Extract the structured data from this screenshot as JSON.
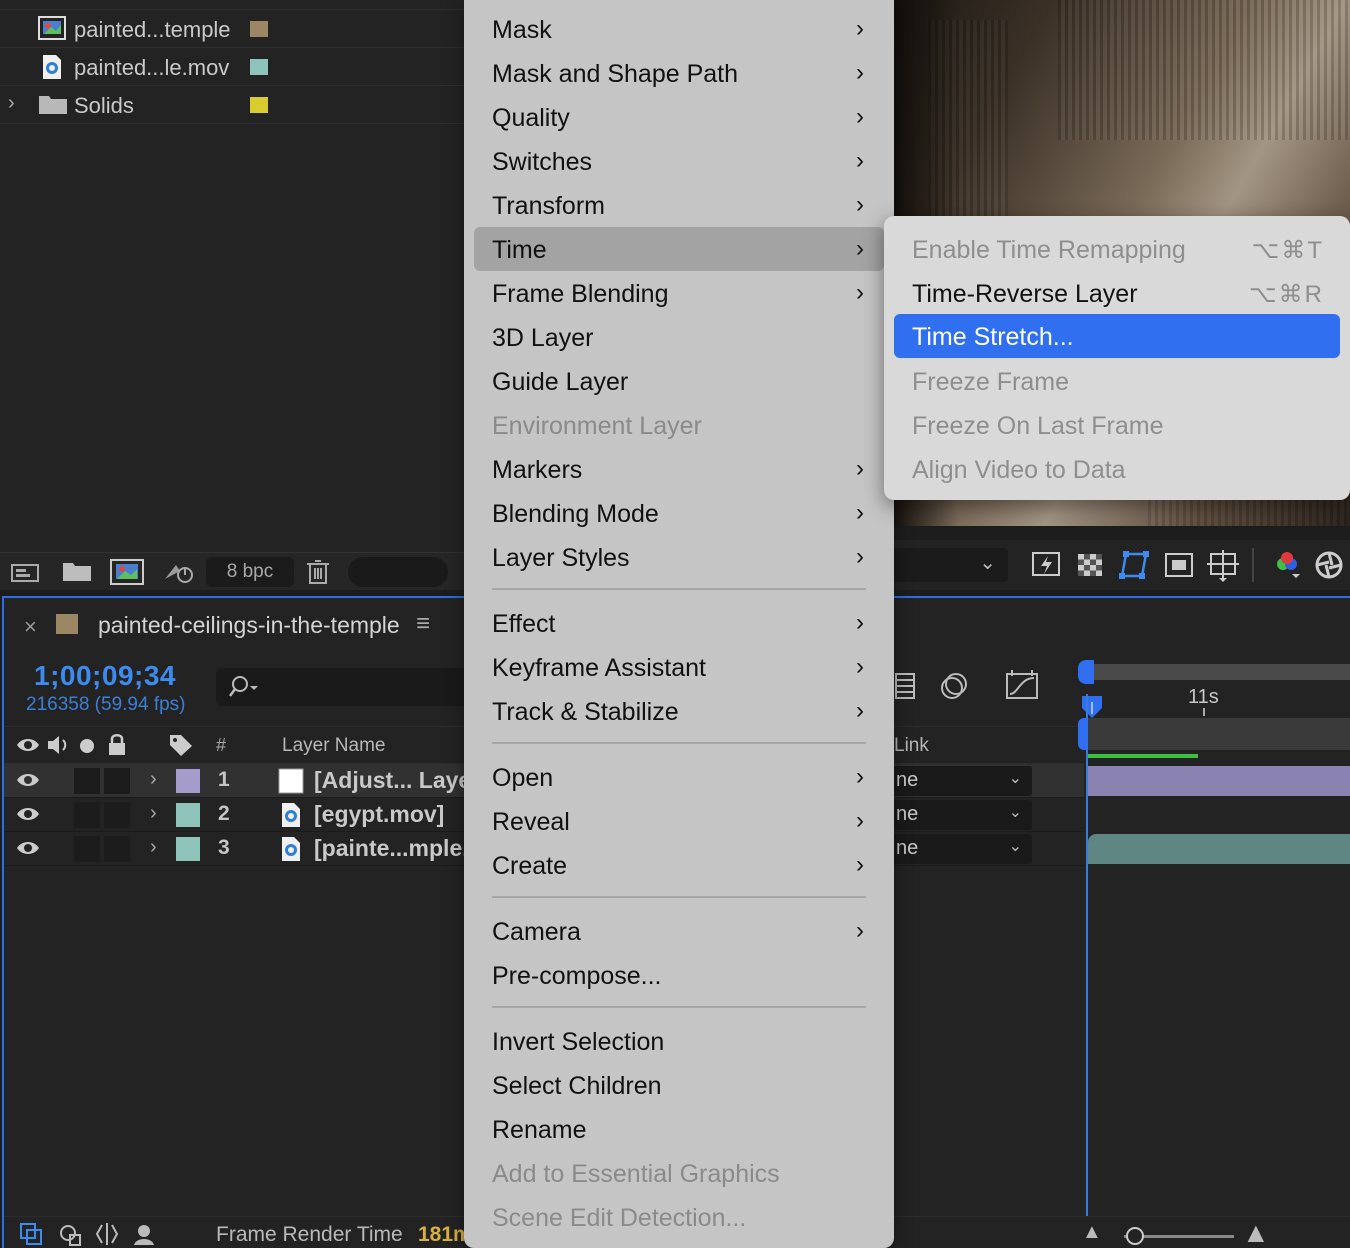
{
  "project": {
    "items": [
      {
        "name": "painted...temple",
        "swatch": "#9c8765",
        "icon": "composition-icon"
      },
      {
        "name": "painted...le.mov",
        "swatch": "#8fc4bb",
        "icon": "movie-file-icon"
      },
      {
        "name": "Solids",
        "swatch": "#d8cc2e",
        "icon": "folder-icon"
      }
    ],
    "bpc": "8 bpc"
  },
  "timeline": {
    "comp_name": "painted-ceilings-in-the-temple",
    "timecode": "1;00;09;34",
    "frames": "216358 (59.94 fps)",
    "headers": {
      "num": "#",
      "layer_name": "Layer Name",
      "link": "Link"
    },
    "time_label": "11s",
    "layers": [
      {
        "num": "1",
        "name": "[Adjust... Layer",
        "label_color": "#a69ccb",
        "link": "ne",
        "selected": true
      },
      {
        "num": "2",
        "name": "[egypt.mov]",
        "label_color": "#8fc4bb",
        "link": "ne",
        "selected": false
      },
      {
        "num": "3",
        "name": "[painte...mple.m",
        "label_color": "#8fc4bb",
        "link": "ne",
        "selected": false
      }
    ],
    "frame_render_label": "Frame Render Time",
    "frame_render_value": "181m"
  },
  "menu": {
    "items": [
      {
        "label": "Mask",
        "submenu": true
      },
      {
        "label": "Mask and Shape Path",
        "submenu": true
      },
      {
        "label": "Quality",
        "submenu": true
      },
      {
        "label": "Switches",
        "submenu": true
      },
      {
        "label": "Transform",
        "submenu": true
      },
      {
        "label": "Time",
        "submenu": true
      },
      {
        "label": "Frame Blending",
        "submenu": true
      },
      {
        "label": "3D Layer",
        "submenu": false
      },
      {
        "label": "Guide Layer",
        "submenu": false
      },
      {
        "label": "Environment Layer",
        "submenu": false
      },
      {
        "label": "Markers",
        "submenu": true
      },
      {
        "label": "Blending Mode",
        "submenu": true
      },
      {
        "label": "Layer Styles",
        "submenu": true
      },
      {
        "label": "Effect",
        "submenu": true
      },
      {
        "label": "Keyframe Assistant",
        "submenu": true
      },
      {
        "label": "Track & Stabilize",
        "submenu": true
      },
      {
        "label": "Open",
        "submenu": true
      },
      {
        "label": "Reveal",
        "submenu": true
      },
      {
        "label": "Create",
        "submenu": true
      },
      {
        "label": "Camera",
        "submenu": true
      },
      {
        "label": "Pre-compose...",
        "submenu": false
      },
      {
        "label": "Invert Selection",
        "submenu": false
      },
      {
        "label": "Select Children",
        "submenu": false
      },
      {
        "label": "Rename",
        "submenu": false
      },
      {
        "label": "Add to Essential Graphics",
        "submenu": false
      },
      {
        "label": "Scene Edit Detection...",
        "submenu": false
      }
    ],
    "highlighted": "Time",
    "disabled": [
      "Environment Layer",
      "Add to Essential Graphics",
      "Scene Edit Detection..."
    ]
  },
  "time_submenu": {
    "items": [
      {
        "label": "Enable Time Remapping",
        "shortcut": "⌥⌘T",
        "disabled": true
      },
      {
        "label": "Time-Reverse Layer",
        "shortcut": "⌥⌘R",
        "disabled": false
      },
      {
        "label": "Time Stretch...",
        "shortcut": "",
        "disabled": false,
        "active": true
      },
      {
        "label": "Freeze Frame",
        "shortcut": "",
        "disabled": true
      },
      {
        "label": "Freeze On Last Frame",
        "shortcut": "",
        "disabled": true
      },
      {
        "label": "Align Video to Data",
        "shortcut": "",
        "disabled": true
      }
    ]
  },
  "colors": {
    "accent": "#2f6ff0",
    "timecode": "#3c8bf0",
    "menu_bg": "#c5c5c5",
    "menu_highlight": "#a3a3a3",
    "submenu_bg": "#d9d9d9"
  }
}
